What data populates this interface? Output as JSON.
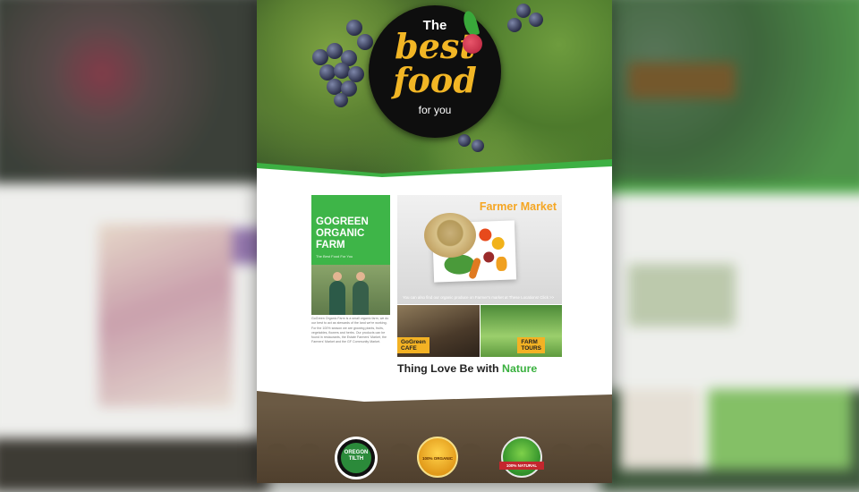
{
  "hero": {
    "logo_the": "The",
    "logo_best": "best",
    "logo_food": "food",
    "logo_for_you": "for you"
  },
  "farm_card": {
    "title_line1": "GOGREEN",
    "title_line2": "ORGANIC",
    "title_line3": "FARM",
    "subtitle": "The Best Food For You",
    "description": "GoGreen Organic Farm is a small organic farm, we do our best to act as stewards of the land we're working. For the 100% season we are growing plants, fruits, vegetables, flowers and herbs. Our products can be found in restaurants, the Estate Farmers' Market, the Farmers' Market and the GF Community Market."
  },
  "market": {
    "title": "Farmer Market",
    "caption": "You can also find our organic produce on Farmer's market at These Locations! Click >>"
  },
  "cafe": {
    "label_line1": "GoGreen",
    "label_line2": "CAFE"
  },
  "tours": {
    "label_line1": "FARM",
    "label_line2": "TOURS"
  },
  "tagline": {
    "text": "Thing Love Be with ",
    "highlight": "Nature"
  },
  "badges": [
    {
      "line1": "OREGON",
      "line2": "TILTH"
    },
    {
      "text": "100% ORGANIC"
    },
    {
      "text": "100% NATURAL"
    }
  ],
  "colors": {
    "brand_green": "#3eb548",
    "accent_gold": "#f2b625",
    "market_orange": "#f5a623"
  }
}
